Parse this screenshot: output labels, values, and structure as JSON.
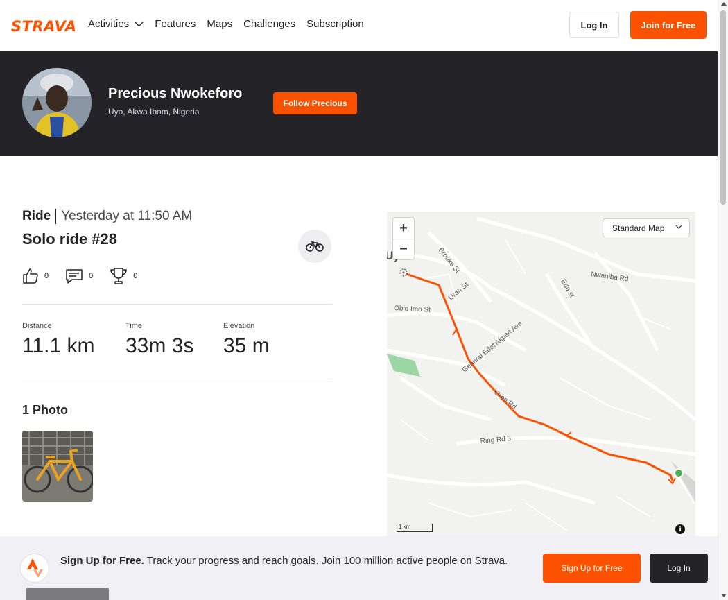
{
  "nav": {
    "logo": "STRAVA",
    "links": [
      "Activities",
      "Features",
      "Maps",
      "Challenges",
      "Subscription"
    ],
    "login": "Log In",
    "join": "Join for Free"
  },
  "athlete": {
    "name": "Precious Nwokeforo",
    "location": "Uyo, Akwa Ibom, Nigeria",
    "follow": "Follow Precious"
  },
  "activity": {
    "type": "Ride",
    "time": "Yesterday at 11:50 AM",
    "title": "Solo ride #28",
    "kudos": "0",
    "comments": "0",
    "achievements": "0",
    "stats": [
      {
        "label": "Distance",
        "value": "11.1 km"
      },
      {
        "label": "Time",
        "value": "33m 3s"
      },
      {
        "label": "Elevation",
        "value": "35 m"
      }
    ],
    "photos_title": "1 Photo"
  },
  "map": {
    "zoom_in": "+",
    "zoom_out": "−",
    "style": "Standard Map",
    "scale": "1 km",
    "info": "i",
    "labels": {
      "brooks": "Brooks St",
      "uran": "Uran St",
      "nwaniba": "Nwaniba Rd",
      "eda": "Eda st",
      "obio": "Obio Imo St",
      "edet": "General Edet Akpan Ave",
      "oron": "Oron Rd",
      "ring": "Ring Rd 3",
      "uyo": "Uyo"
    },
    "route_color": "#fc5200",
    "start_color": "#4caf50"
  },
  "banner": {
    "headline": "Sign Up for Free.",
    "text": "Track your progress and reach goals. Join 100 million active people on Strava.",
    "signup": "Sign Up for Free",
    "login": "Log In"
  }
}
